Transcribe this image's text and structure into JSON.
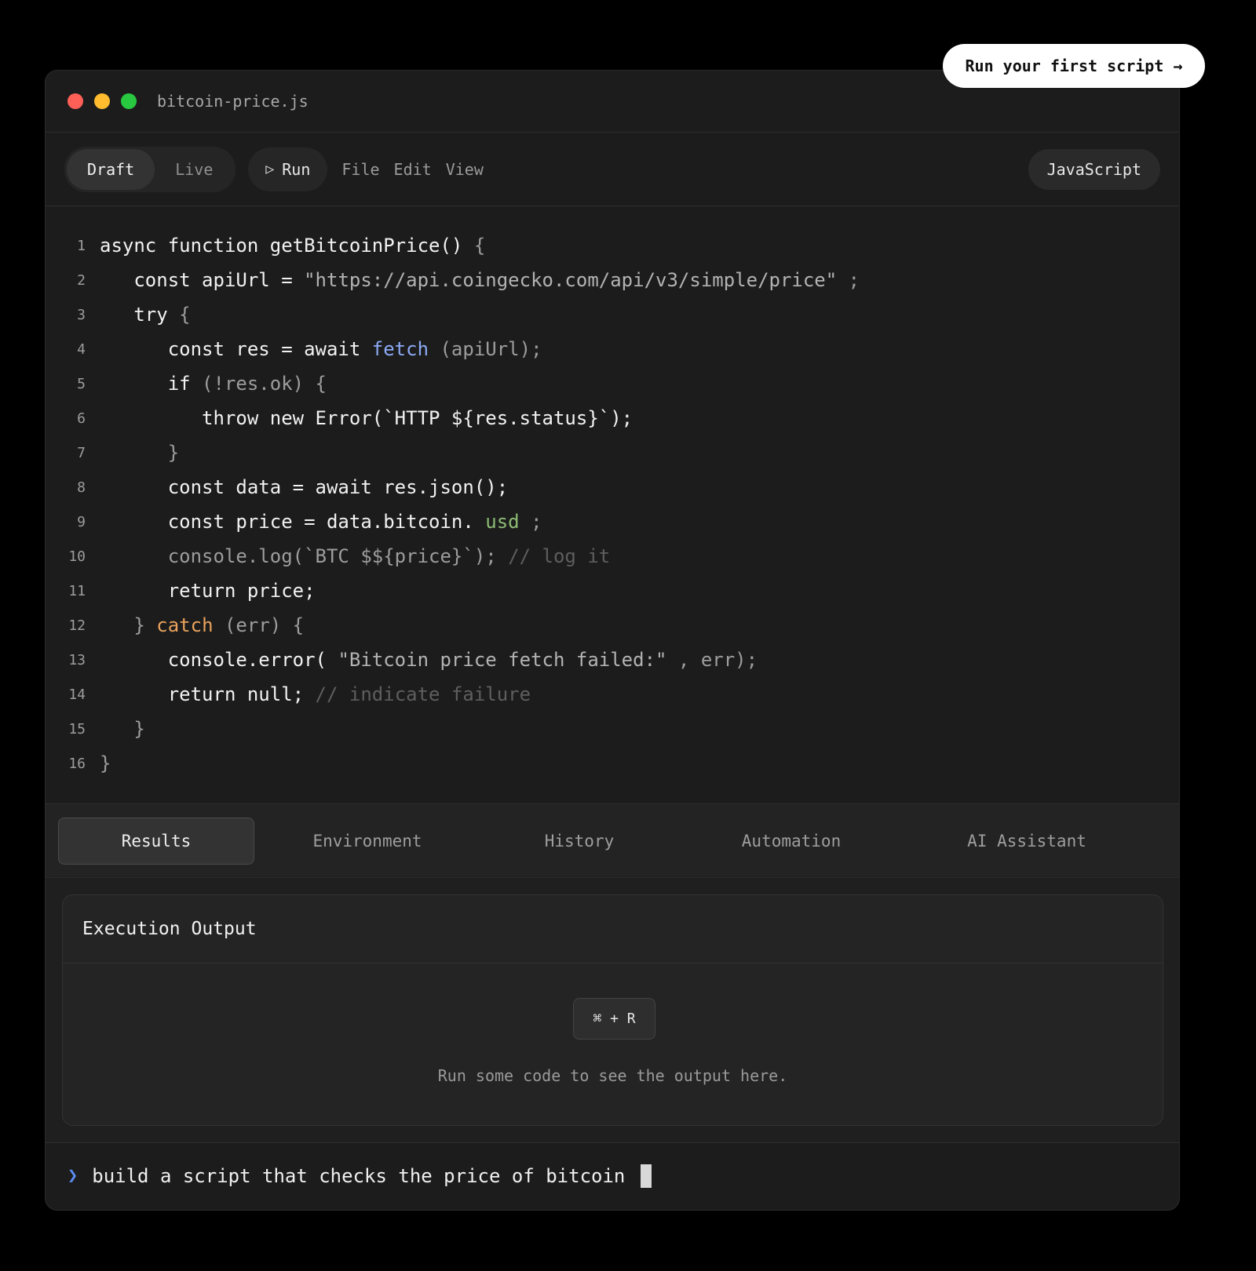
{
  "cta": {
    "label": "Run your first script →"
  },
  "window": {
    "filename": "bitcoin-price.js",
    "controls": [
      "close",
      "minimize",
      "zoom"
    ]
  },
  "toolbar": {
    "mode_draft": "Draft",
    "mode_live": "Live",
    "active_mode": "Draft",
    "run_icon": "▷",
    "run_label": "Run",
    "menu": [
      "File",
      "Edit",
      "View"
    ],
    "language": "JavaScript"
  },
  "editor": {
    "line_numbers": [
      "1",
      "2",
      "3",
      "4",
      "5",
      "6",
      "7",
      "8",
      "9",
      "10",
      "11",
      "12",
      "13",
      "14",
      "15",
      "16"
    ]
  },
  "tabs": {
    "items": [
      "Results",
      "Environment",
      "History",
      "Automation",
      "AI Assistant"
    ],
    "active": "Results"
  },
  "output": {
    "title": "Execution Output",
    "shortcut": "⌘ + R",
    "empty_message": "Run some code to see the output here."
  },
  "prompt": {
    "chevron": "❯",
    "text": "build a script that checks the price of bitcoin"
  },
  "colors": {
    "background": "#000000",
    "window": "#1c1c1c",
    "accent_blue": "#8caaf5",
    "accent_green": "#8dbb74",
    "accent_orange": "#e8a25c",
    "prompt_chevron": "#5b8cf0"
  }
}
